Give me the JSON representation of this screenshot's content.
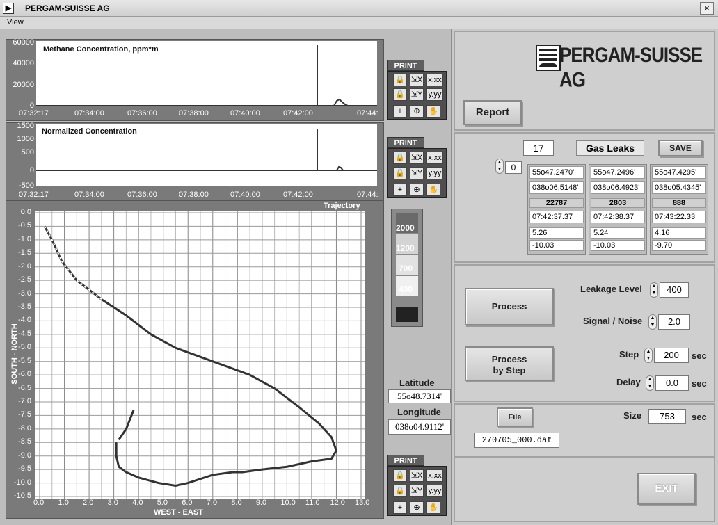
{
  "window": {
    "title": "PERGAM-SUISSE AG",
    "close": "×",
    "app_icon": "▶"
  },
  "menu": {
    "view": "View"
  },
  "graph1": {
    "label": "Methane Concentration, ppm*m",
    "y_ticks": [
      "60000",
      "40000",
      "20000",
      "0"
    ],
    "x_ticks": [
      "07:32:17",
      "07:34:00",
      "07:36:00",
      "07:38:00",
      "07:40:00",
      "07:42:00",
      "07:44:"
    ]
  },
  "graph2": {
    "label": "Normalized Concentration",
    "y_ticks": [
      "1500",
      "1000",
      "500",
      "0",
      "-500"
    ],
    "x_ticks": [
      "07:32:17",
      "07:34:00",
      "07:36:00",
      "07:38:00",
      "07:40:00",
      "07:42:00",
      "07:44:"
    ]
  },
  "trajectory": {
    "label": "Trajectory",
    "xlabel": "WEST - EAST",
    "ylabel": "SOUTH - NORTH",
    "y_ticks": [
      "0.0",
      "-0.5",
      "-1.0",
      "-1.5",
      "-2.0",
      "-2.5",
      "-3.0",
      "-3.5",
      "-4.0",
      "-4.5",
      "-5.0",
      "-5.5",
      "-6.0",
      "-6.5",
      "-7.0",
      "-7.5",
      "-8.0",
      "-8.5",
      "-9.0",
      "-9.5",
      "-10.0",
      "-10.5"
    ],
    "x_ticks": [
      "0.0",
      "1.0",
      "2.0",
      "3.0",
      "4.0",
      "5.0",
      "6.0",
      "7.0",
      "8.0",
      "9.0",
      "10.0",
      "11.0",
      "12.0",
      "13.0"
    ]
  },
  "print_label": "PRINT",
  "tools": {
    "lock": "🔒",
    "x_scale": "⇲X",
    "x_format": "x.xx",
    "y_scale": "⇲Y",
    "y_format": "y.yy",
    "cursor": "+",
    "zoom": "⊕",
    "hand": "✋"
  },
  "colorscale": {
    "ticks": [
      "2000",
      "1200",
      "700",
      "400"
    ],
    "colors": [
      "#6a6a6a",
      "#d4d4d4",
      "#e2e2e2",
      "#f0f0f0",
      "#222222"
    ]
  },
  "position": {
    "latitude_label": "Latitude",
    "latitude": "55o48.7314'",
    "longitude_label": "Longitude",
    "longitude": "038o04.9112'"
  },
  "brand": {
    "name": "PERGAM-SUISSE AG"
  },
  "report_button": "Report",
  "leaks": {
    "count": "17",
    "title": "Gas Leaks",
    "save": "SAVE",
    "index": "0",
    "columns": [
      {
        "lat": "55o47.2470'",
        "lon": "038o06.5148'",
        "value": "22787",
        "time": "07:42:37.37",
        "a": "5.26",
        "b": "-10.03"
      },
      {
        "lat": "55o47.2496'",
        "lon": "038o06.4923'",
        "value": "2803",
        "time": "07:42:38.37",
        "a": "5.24",
        "b": "-10.03"
      },
      {
        "lat": "55o47.4295'",
        "lon": "038o05.4345'",
        "value": "888",
        "time": "07:43:22.33",
        "a": "4.16",
        "b": "-9.70"
      }
    ]
  },
  "process": {
    "process_button": "Process",
    "process_step_line1": "Process",
    "process_step_line2": "by Step",
    "leakage_label": "Leakage Level",
    "leakage": "400",
    "sn_label": "Signal / Noise",
    "sn": "2.0",
    "step_label": "Step",
    "step": "200",
    "delay_label": "Delay",
    "delay": "0.0",
    "unit": "sec"
  },
  "file": {
    "button": "File",
    "name": "270705_000.dat",
    "size_label": "Size",
    "size": "753",
    "unit": "sec"
  },
  "exit_button": "EXIT",
  "chart_data": {
    "type": "line",
    "title": "Trajectory",
    "xlabel": "WEST - EAST",
    "ylabel": "SOUTH - NORTH",
    "xlim": [
      0.0,
      13.0
    ],
    "ylim": [
      -10.5,
      0.0
    ],
    "series": [
      {
        "values": [
          [
            0.2,
            -0.5
          ],
          [
            0.5,
            -1.0
          ],
          [
            0.9,
            -1.8
          ],
          [
            1.5,
            -2.5
          ],
          [
            2.5,
            -3.2
          ],
          [
            3.5,
            -3.8
          ],
          [
            4.5,
            -4.5
          ],
          [
            5.5,
            -5.0
          ],
          [
            7.0,
            -5.5
          ],
          [
            8.5,
            -6.0
          ],
          [
            9.5,
            -6.5
          ],
          [
            10.5,
            -7.2
          ],
          [
            11.3,
            -7.8
          ],
          [
            11.8,
            -8.3
          ],
          [
            12.0,
            -8.8
          ],
          [
            11.8,
            -9.1
          ],
          [
            11.0,
            -9.2
          ],
          [
            10.0,
            -9.4
          ],
          [
            9.0,
            -9.5
          ],
          [
            8.2,
            -9.6
          ],
          [
            7.8,
            -9.6
          ],
          [
            7.0,
            -9.7
          ],
          [
            6.0,
            -10.0
          ],
          [
            5.5,
            -10.1
          ],
          [
            4.8,
            -10.0
          ],
          [
            4.0,
            -9.8
          ],
          [
            3.5,
            -9.6
          ],
          [
            3.2,
            -9.4
          ],
          [
            3.1,
            -9.0
          ],
          [
            3.1,
            -8.5
          ]
        ]
      },
      {
        "values": [
          [
            3.2,
            -8.4
          ],
          [
            3.5,
            -8.0
          ],
          [
            3.8,
            -7.3
          ]
        ]
      }
    ]
  }
}
